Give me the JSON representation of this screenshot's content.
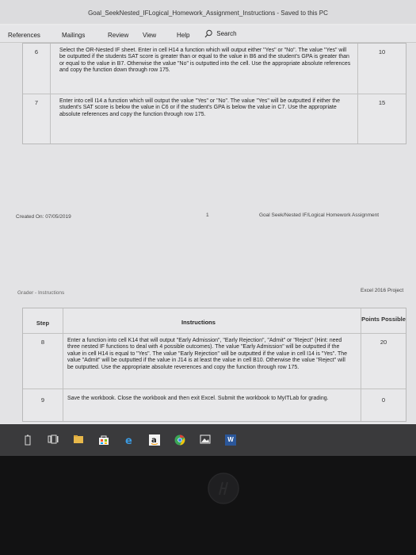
{
  "window": {
    "title": "Goal_SeekNested_IFLogical_Homework_Assignment_Instructions  -  Saved to this PC"
  },
  "ribbon": {
    "tabs": [
      "References",
      "Mailings",
      "Review",
      "View",
      "Help"
    ],
    "search_label": "Search"
  },
  "page1": {
    "rows": [
      {
        "step": "6",
        "text": "Select the OR-Nested IF sheet. Enter in cell H14 a function which will output either \"Yes\" or \"No\". The value \"Yes\" will be outputted if the students SAT score is greater than or equal to the value in B6 and the student's GPA is greater than or equal to the value in B7. Otherwise the value \"No\" is outputted into the cell. Use the appropriate absolute references and copy the function down through row 175.",
        "points": "10"
      },
      {
        "step": "7",
        "text": "Enter into cell I14 a function which will output the value \"Yes\" or \"No\". The value \"Yes\" will be outputted if either the student's SAT score is below the value in C6 or if the student's GPA is below the value in C7. Use the appropriate absolute references and copy the function through row 175.",
        "points": "15"
      }
    ],
    "footer": {
      "created": "Created On: 07/05/2019",
      "page_number": "1",
      "assignment": "Goal Seek/Nested IF/Logical Homework Assignment"
    }
  },
  "page2": {
    "header": {
      "left": "Grader - Instructions",
      "right": "Excel 2016 Project"
    },
    "columns": {
      "step": "Step",
      "instructions": "Instructions",
      "points": "Points Possible"
    },
    "rows": [
      {
        "step": "8",
        "text": "Enter a function into cell K14 that will output \"Early Admission\", \"Early Rejection\", \"Admit\" or \"Reject\" (Hint: need three nested IF functions to deal with 4 possible outcomes). The value \"Early Admission\" will be outputted if the value in cell H14 is equal to \"Yes\". The value \"Early Rejection\" will be outputted if the value in cell I14 is \"Yes\". The value \"Admit\" will be outputted if the value in J14 is at least the value in cell B10. Otherwise the value \"Reject\" will be outputted. Use the appropriate absolute reverences and copy the function through row 175.",
        "points": "20"
      },
      {
        "step": "9",
        "text": "Save the workbook. Close the workbook and then exit Excel. Submit the workbook to MyITLab for grading.",
        "points": "0"
      }
    ]
  },
  "taskbar": {
    "icons": [
      "battery-icon",
      "task-view-icon",
      "file-explorer-icon",
      "store-icon",
      "edge-icon",
      "amazon-icon",
      "chrome-icon",
      "photos-icon",
      "word-icon"
    ],
    "word_label": "W"
  },
  "colors": {
    "accent_word": "#2b579a",
    "taskbar": "#3a3a3c"
  }
}
